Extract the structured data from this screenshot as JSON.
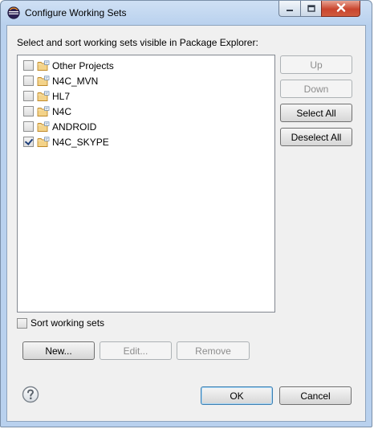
{
  "window": {
    "title": "Configure Working Sets"
  },
  "instruction": "Select and sort working sets visible in Package Explorer:",
  "working_sets": [
    {
      "label": "Other Projects",
      "checked": false
    },
    {
      "label": "N4C_MVN",
      "checked": false
    },
    {
      "label": "HL7",
      "checked": false
    },
    {
      "label": "N4C",
      "checked": false
    },
    {
      "label": "ANDROID",
      "checked": false
    },
    {
      "label": "N4C_SKYPE",
      "checked": true
    }
  ],
  "side_buttons": {
    "up": "Up",
    "down": "Down",
    "select_all": "Select All",
    "deselect_all": "Deselect All"
  },
  "sort_working_sets": {
    "label": "Sort working sets",
    "checked": false
  },
  "action_buttons": {
    "new": "New...",
    "edit": "Edit...",
    "remove": "Remove"
  },
  "dialog_buttons": {
    "ok": "OK",
    "cancel": "Cancel"
  },
  "icons": {
    "title": "eclipse-icon",
    "folder": "working-set-folder-icon",
    "help": "help-icon"
  },
  "colors": {
    "title_bar": "#b9d1ee",
    "dialog_bg": "#f0f0f0",
    "close_button": "#c9452e",
    "default_button_border": "#3c7fb1"
  }
}
